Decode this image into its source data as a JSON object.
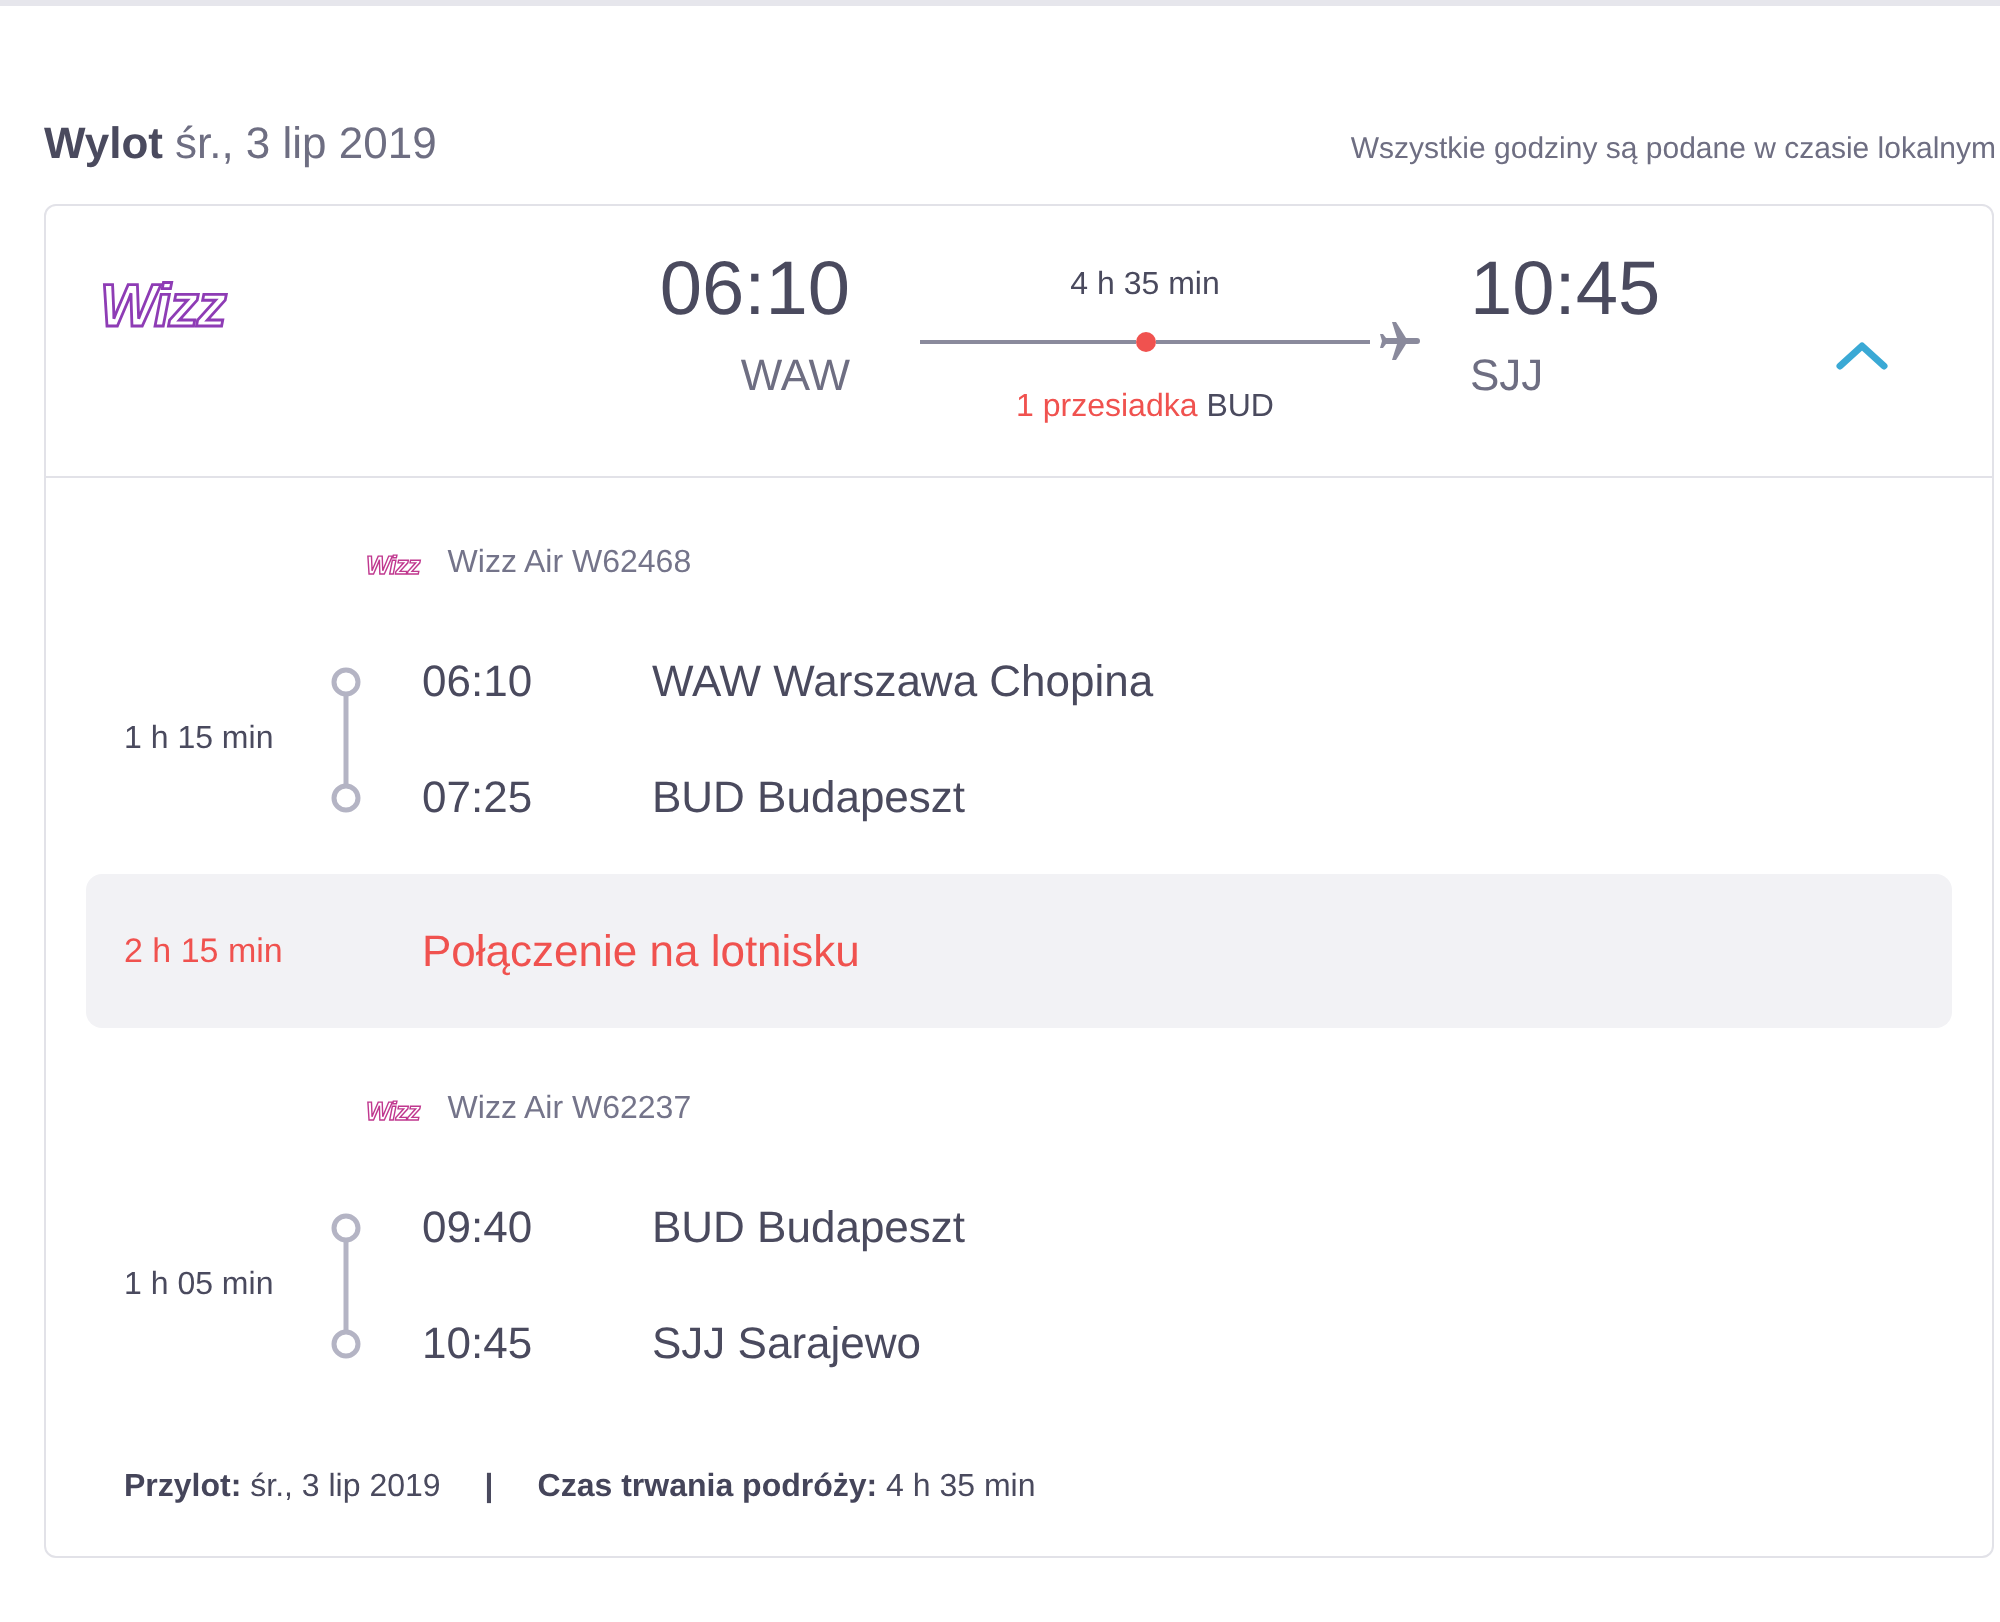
{
  "header": {
    "title": "Wylot",
    "date": "śr., 3 lip 2019",
    "note": "Wszystkie godziny są podane w czasie lokalnym"
  },
  "summary": {
    "logo": "Wizz",
    "departure": {
      "time": "06:10",
      "airport": "WAW"
    },
    "duration": "4 h 35 min",
    "stops": "1 przesiadka",
    "stop_airport": "BUD",
    "arrival": {
      "time": "10:45",
      "airport": "SJJ"
    },
    "expanded": true
  },
  "details": [
    {
      "kind": "flight",
      "logo": "Wizz",
      "flight": "Wizz Air W62468",
      "duration": "1 h 15 min",
      "stops": [
        {
          "time": "06:10",
          "place": "WAW Warszawa Chopina"
        },
        {
          "time": "07:25",
          "place": "BUD Budapeszt"
        }
      ]
    },
    {
      "kind": "layover",
      "duration": "2 h 15 min",
      "label": "Połączenie na lotnisku"
    },
    {
      "kind": "flight",
      "logo": "Wizz",
      "flight": "Wizz Air W62237",
      "duration": "1 h 05 min",
      "stops": [
        {
          "time": "09:40",
          "place": "BUD Budapeszt"
        },
        {
          "time": "10:45",
          "place": "SJJ Sarajewo"
        }
      ]
    }
  ],
  "footer": {
    "items": [
      "**Przylot:** śr., 3 lip 2019",
      "**Czas trwania podróży:** 4 h 35 min"
    ],
    "separator": "|"
  }
}
